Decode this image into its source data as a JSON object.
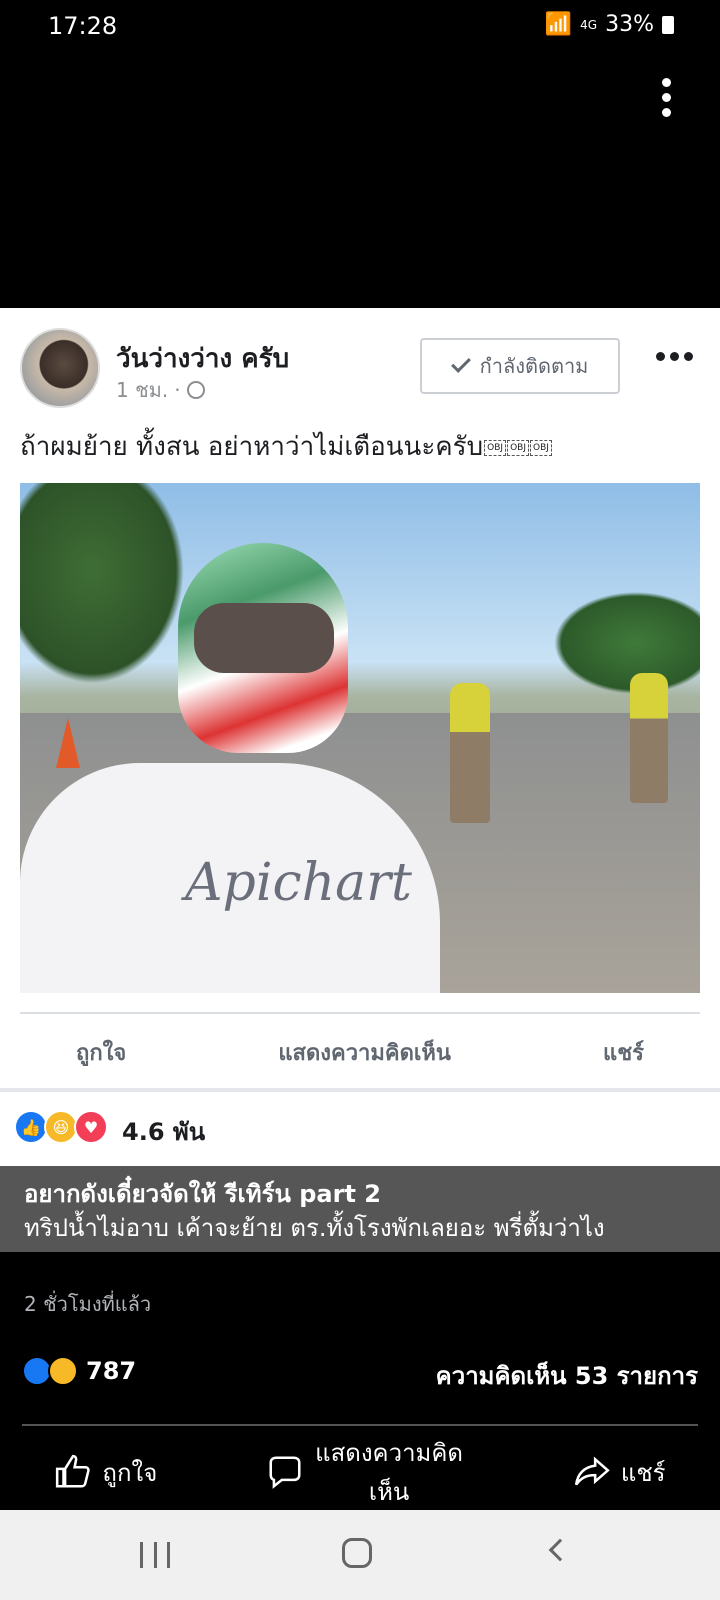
{
  "status": {
    "time": "17:28",
    "battery": "33%",
    "network": "4G"
  },
  "post": {
    "author": "วันว่างว่าง ครับ",
    "time": "1 ชม.",
    "follow_label": "กำลังติดตาม",
    "caption": "ถ้าผมย้าย ทั้งสน อย่าหาว่าไม่เตือนนะครับ",
    "caption_objs": [
      "OBJ",
      "OBJ",
      "OBJ"
    ],
    "photo_logo": "Apichart",
    "actions": {
      "like": "ถูกใจ",
      "comment": "แสดงความคิดเห็น",
      "share": "แชร์"
    },
    "reaction_count": "4.6 พัน"
  },
  "overlay": {
    "title": "อยากดังเดี๋ยวจัดให้ รีเทิร์น part 2",
    "body": "ทริปน้ำไม่อาบ เค้าจะย้าย ตร.ทั้งโรงพักเลยอะ พรี่ตั้มว่าไง"
  },
  "footer": {
    "time_ago": "2 ชั่วโมงที่แล้ว",
    "reaction_count": "787",
    "comments": "ความคิดเห็น 53 รายการ",
    "actions": {
      "like": "ถูกใจ",
      "comment": "แสดงความคิดเห็น",
      "share": "แชร์"
    }
  },
  "colors": {
    "like_blue": "#1877f2",
    "haha_yellow": "#f7b928",
    "love_red": "#f33e58"
  }
}
